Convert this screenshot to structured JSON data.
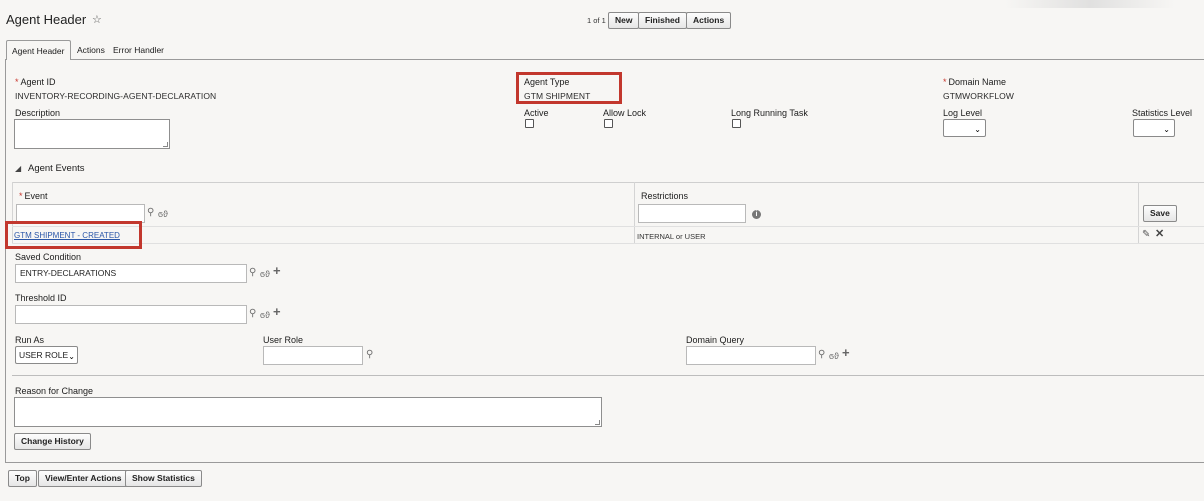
{
  "header": {
    "title": "Agent Header",
    "pager": "1 of 1",
    "buttons": {
      "new": "New",
      "finished": "Finished",
      "actions": "Actions"
    }
  },
  "tabs": [
    {
      "label": "Agent Header",
      "active": true
    },
    {
      "label": "Actions",
      "active": false
    },
    {
      "label": "Error Handler",
      "active": false
    }
  ],
  "fields": {
    "agent_id": {
      "label": "Agent ID",
      "value": "INVENTORY-RECORDING-AGENT-DECLARATION"
    },
    "agent_type": {
      "label": "Agent Type",
      "value": "GTM SHIPMENT"
    },
    "domain_name": {
      "label": "Domain Name",
      "value": "GTMWORKFLOW"
    },
    "description": {
      "label": "Description"
    },
    "active": {
      "label": "Active"
    },
    "allow_lock": {
      "label": "Allow Lock"
    },
    "long_running_task": {
      "label": "Long Running Task"
    },
    "log_level": {
      "label": "Log Level"
    },
    "statistics_level": {
      "label": "Statistics Level"
    }
  },
  "agent_events": {
    "section_label": "Agent Events",
    "event_label": "Event",
    "restrictions_label": "Restrictions",
    "save_label": "Save",
    "row": {
      "event": "GTM SHIPMENT - CREATED",
      "restrictions": "INTERNAL or USER"
    }
  },
  "saved_condition": {
    "label": "Saved Condition",
    "value": "ENTRY-DECLARATIONS"
  },
  "threshold_id": {
    "label": "Threshold ID",
    "value": ""
  },
  "run_as": {
    "label": "Run As",
    "value": "USER ROLE"
  },
  "user_role": {
    "label": "User Role",
    "value": ""
  },
  "domain_query": {
    "label": "Domain Query",
    "value": ""
  },
  "reason_for_change": {
    "label": "Reason for Change"
  },
  "change_history_label": "Change History",
  "footer": {
    "top": "Top",
    "view_enter_actions": "View/Enter Actions",
    "show_statistics": "Show Statistics"
  },
  "colors": {
    "highlight": "#c2372d",
    "link": "#2a56a8",
    "required": "#c8362d"
  }
}
